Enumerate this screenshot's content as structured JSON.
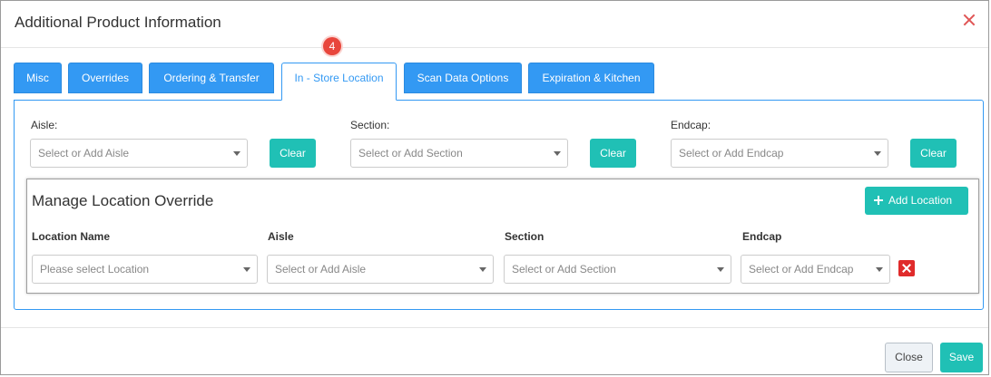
{
  "modal": {
    "title": "Additional Product Information"
  },
  "tabs": [
    {
      "label": "Misc",
      "active": false
    },
    {
      "label": "Overrides",
      "active": false
    },
    {
      "label": "Ordering & Transfer",
      "active": false
    },
    {
      "label": "In - Store Location",
      "active": true
    },
    {
      "label": "Scan Data Options",
      "active": false
    },
    {
      "label": "Expiration & Kitchen",
      "active": false
    }
  ],
  "step_badge": "4",
  "location_fields": {
    "aisle": {
      "label": "Aisle:",
      "placeholder": "Select or Add Aisle",
      "clear_label": "Clear"
    },
    "section": {
      "label": "Section:",
      "placeholder": "Select or Add Section",
      "clear_label": "Clear"
    },
    "endcap": {
      "label": "Endcap:",
      "placeholder": "Select or Add Endcap",
      "clear_label": "Clear"
    }
  },
  "override": {
    "title": "Manage Location Override",
    "add_button_label": "Add Location",
    "columns": [
      "Location Name",
      "Aisle",
      "Section",
      "Endcap"
    ],
    "row": {
      "location_placeholder": "Please select Location",
      "aisle_placeholder": "Select or Add Aisle",
      "section_placeholder": "Select or Add Section",
      "endcap_placeholder": "Select or Add Endcap"
    }
  },
  "footer": {
    "close_label": "Close",
    "save_label": "Save"
  },
  "colors": {
    "tab_blue": "#3399f3",
    "teal": "#20c0b5",
    "danger": "#e02b2b",
    "badge_red": "#e8463c"
  },
  "icons": {
    "modal_close": "close-icon",
    "add_location": "plus-icon",
    "delete_row": "delete-icon",
    "dropdown": "caret-down-icon"
  }
}
